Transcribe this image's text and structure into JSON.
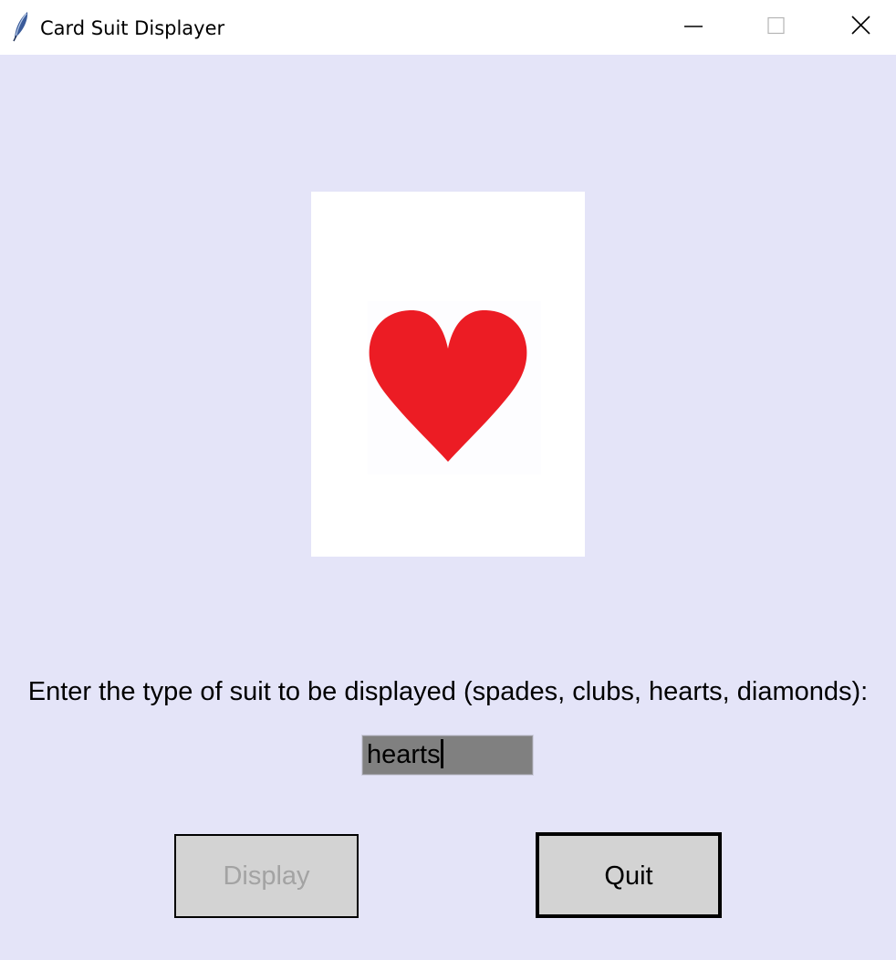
{
  "window": {
    "title": "Card Suit Displayer",
    "icon": "feather-icon",
    "controls": {
      "minimize": "minimize-icon",
      "maximize": "maximize-icon",
      "close": "close-icon"
    }
  },
  "card": {
    "suit_icon": "heart-icon",
    "suit_color": "#ec1c24"
  },
  "form": {
    "prompt": "Enter the type of suit to be displayed (spades, clubs, hearts, diamonds):",
    "suit_value": "hearts"
  },
  "buttons": {
    "display_label": "Display",
    "quit_label": "Quit"
  },
  "colors": {
    "background": "#e4e4f8",
    "button_face": "#d3d3d3",
    "input_fill": "#808080",
    "disabled_text": "#a3a3a3"
  }
}
